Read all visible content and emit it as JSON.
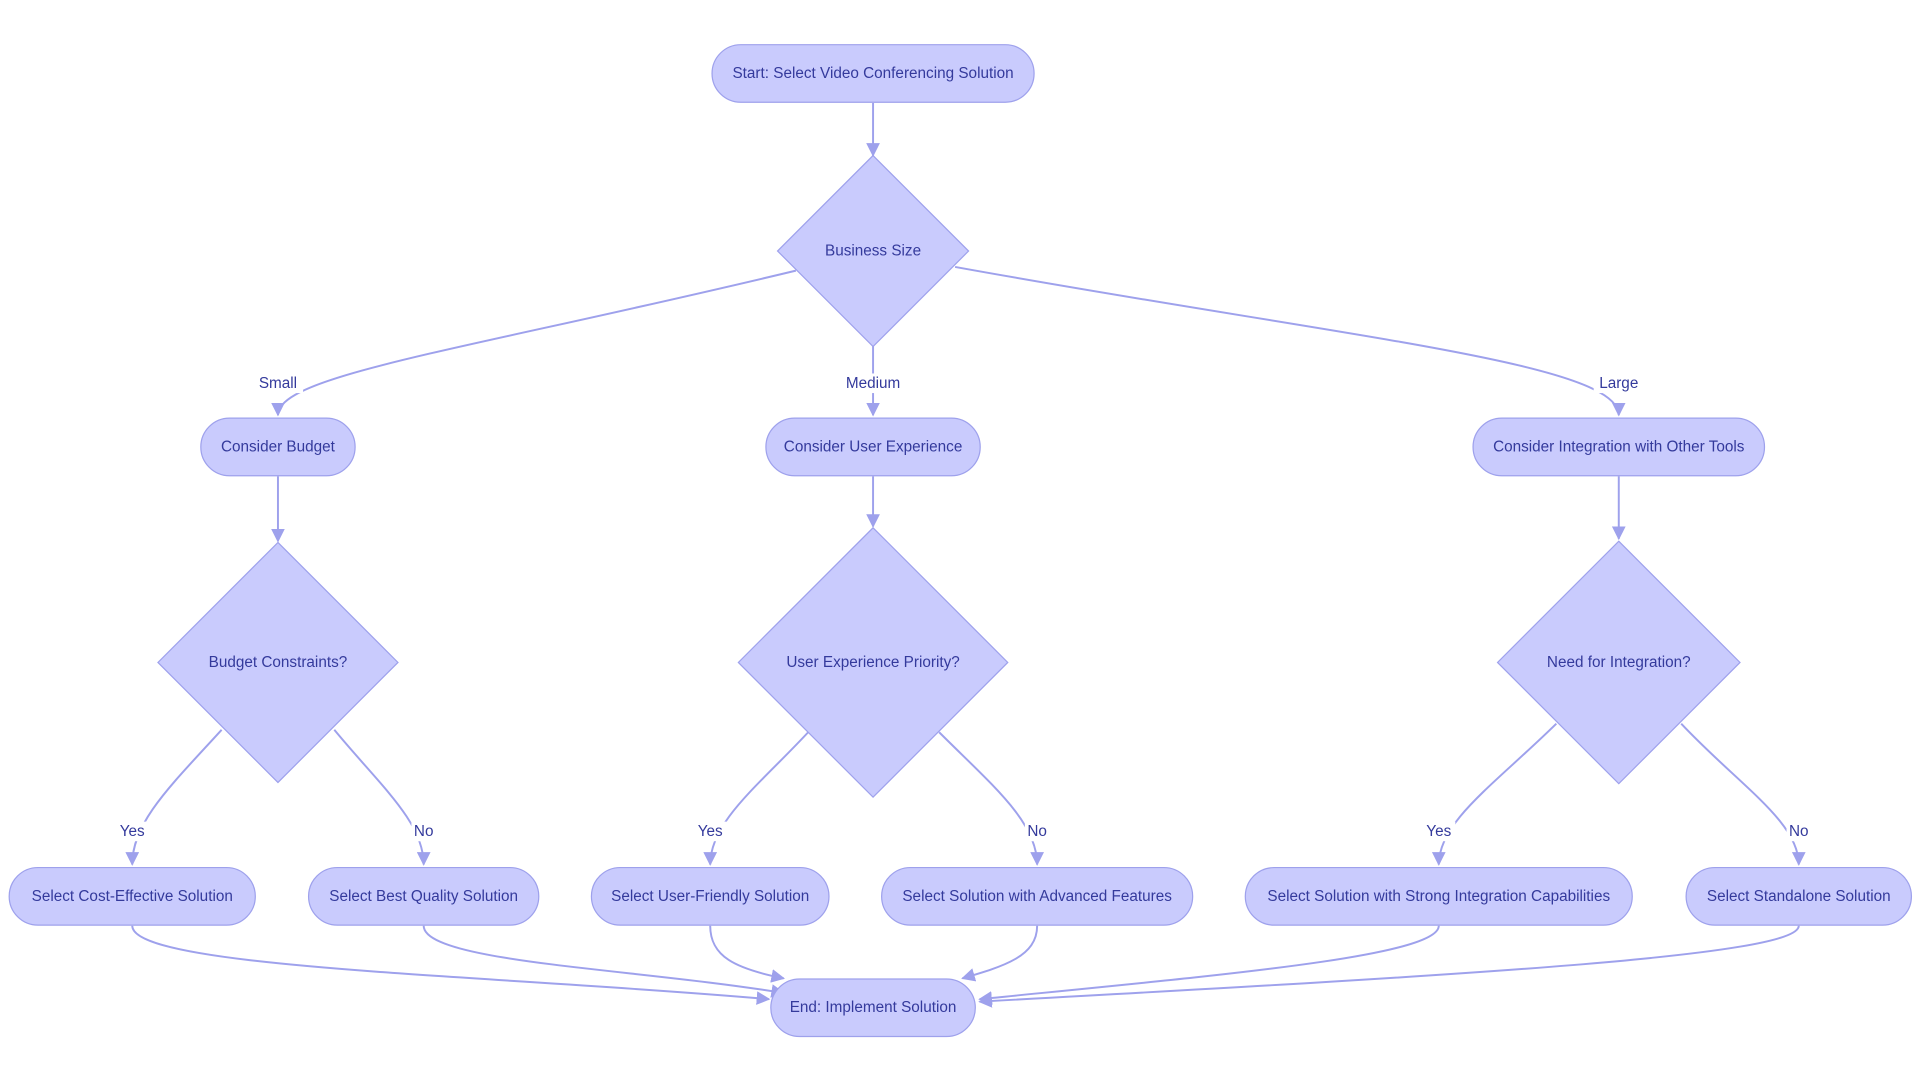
{
  "colors": {
    "node_fill": "#c9cbfd",
    "node_stroke": "#9ea1ec",
    "text": "#343a9c",
    "edge": "#9ea1ec",
    "background": "#ffffff"
  },
  "nodes": [
    {
      "id": "start",
      "label": "Start: Select Video Conferencing Solution",
      "shape": "rounded"
    },
    {
      "id": "size",
      "label": "Business Size",
      "shape": "diamond"
    },
    {
      "id": "budget",
      "label": "Consider Budget",
      "shape": "rounded"
    },
    {
      "id": "ux",
      "label": "Consider User Experience",
      "shape": "rounded"
    },
    {
      "id": "integ",
      "label": "Consider Integration with Other Tools",
      "shape": "rounded"
    },
    {
      "id": "budgetq",
      "label": "Budget Constraints?",
      "shape": "diamond"
    },
    {
      "id": "uxq",
      "label": "User Experience Priority?",
      "shape": "diamond"
    },
    {
      "id": "integq",
      "label": "Need for Integration?",
      "shape": "diamond"
    },
    {
      "id": "cost",
      "label": "Select Cost-Effective Solution",
      "shape": "rounded"
    },
    {
      "id": "quality",
      "label": "Select Best Quality Solution",
      "shape": "rounded"
    },
    {
      "id": "friendly",
      "label": "Select User-Friendly Solution",
      "shape": "rounded"
    },
    {
      "id": "advanced",
      "label": "Select Solution with Advanced Features",
      "shape": "rounded"
    },
    {
      "id": "strong",
      "label": "Select Solution with Strong Integration Capabilities",
      "shape": "rounded"
    },
    {
      "id": "standalone",
      "label": "Select Standalone Solution",
      "shape": "rounded"
    },
    {
      "id": "end",
      "label": "End: Implement Solution",
      "shape": "rounded"
    }
  ],
  "edges": [
    {
      "from": "start",
      "to": "size",
      "label": ""
    },
    {
      "from": "size",
      "to": "budget",
      "label": "Small"
    },
    {
      "from": "size",
      "to": "ux",
      "label": "Medium"
    },
    {
      "from": "size",
      "to": "integ",
      "label": "Large"
    },
    {
      "from": "budget",
      "to": "budgetq",
      "label": ""
    },
    {
      "from": "ux",
      "to": "uxq",
      "label": ""
    },
    {
      "from": "integ",
      "to": "integq",
      "label": ""
    },
    {
      "from": "budgetq",
      "to": "cost",
      "label": "Yes"
    },
    {
      "from": "budgetq",
      "to": "quality",
      "label": "No"
    },
    {
      "from": "uxq",
      "to": "friendly",
      "label": "Yes"
    },
    {
      "from": "uxq",
      "to": "advanced",
      "label": "No"
    },
    {
      "from": "integq",
      "to": "strong",
      "label": "Yes"
    },
    {
      "from": "integq",
      "to": "standalone",
      "label": "No"
    },
    {
      "from": "cost",
      "to": "end",
      "label": ""
    },
    {
      "from": "quality",
      "to": "end",
      "label": ""
    },
    {
      "from": "friendly",
      "to": "end",
      "label": ""
    },
    {
      "from": "advanced",
      "to": "end",
      "label": ""
    },
    {
      "from": "strong",
      "to": "end",
      "label": ""
    },
    {
      "from": "standalone",
      "to": "end",
      "label": ""
    }
  ]
}
